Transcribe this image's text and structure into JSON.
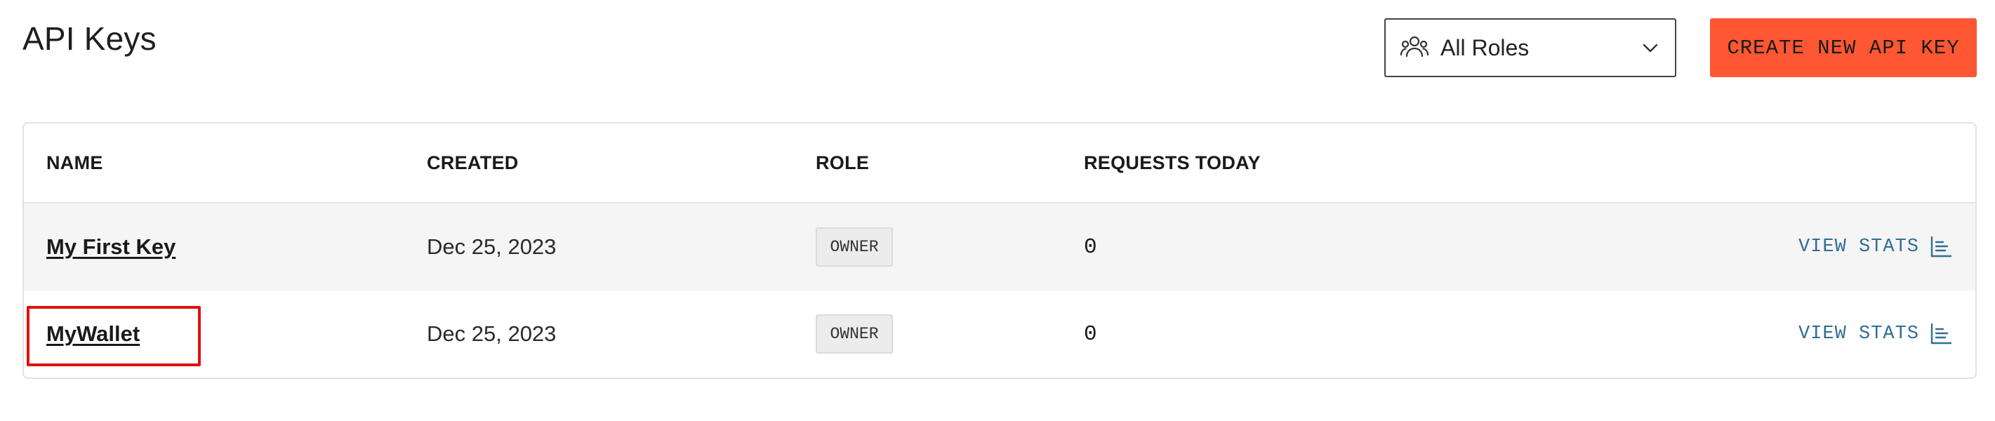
{
  "page": {
    "title": "API Keys"
  },
  "filter": {
    "selected": "All Roles",
    "icon": "people-icon"
  },
  "actions": {
    "create_label": "CREATE NEW API KEY",
    "accent": "#ff5733"
  },
  "table": {
    "columns": [
      "NAME",
      "CREATED",
      "ROLE",
      "REQUESTS TODAY"
    ],
    "rows": [
      {
        "name": "My First Key",
        "created": "Dec 25, 2023",
        "role": "OWNER",
        "requests_today": "0",
        "action": "VIEW STATS"
      },
      {
        "name": "MyWallet",
        "created": "Dec 25, 2023",
        "role": "OWNER",
        "requests_today": "0",
        "action": "VIEW STATS"
      }
    ]
  },
  "colors": {
    "link": "#2f6f95",
    "highlight": "#e01010",
    "row_alt": "#f5f5f5"
  }
}
